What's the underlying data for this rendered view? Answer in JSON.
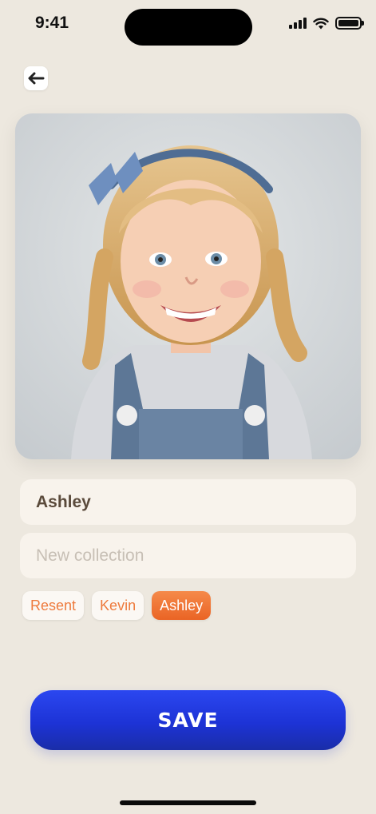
{
  "status": {
    "time": "9:41"
  },
  "back": {
    "icon": "arrow-left-icon"
  },
  "photo": {
    "icon": "child-portrait-photo"
  },
  "form": {
    "name_value": "Ashley",
    "collection_placeholder": "New collection"
  },
  "chips": [
    {
      "label": "Resent",
      "active": false
    },
    {
      "label": "Kevin",
      "active": false
    },
    {
      "label": "Ashley",
      "active": true
    }
  ],
  "save": {
    "label": "SAVE"
  },
  "colors": {
    "background": "#ede8df",
    "accent_orange": "#ee7a3c",
    "save_blue": "#1d33d6"
  }
}
